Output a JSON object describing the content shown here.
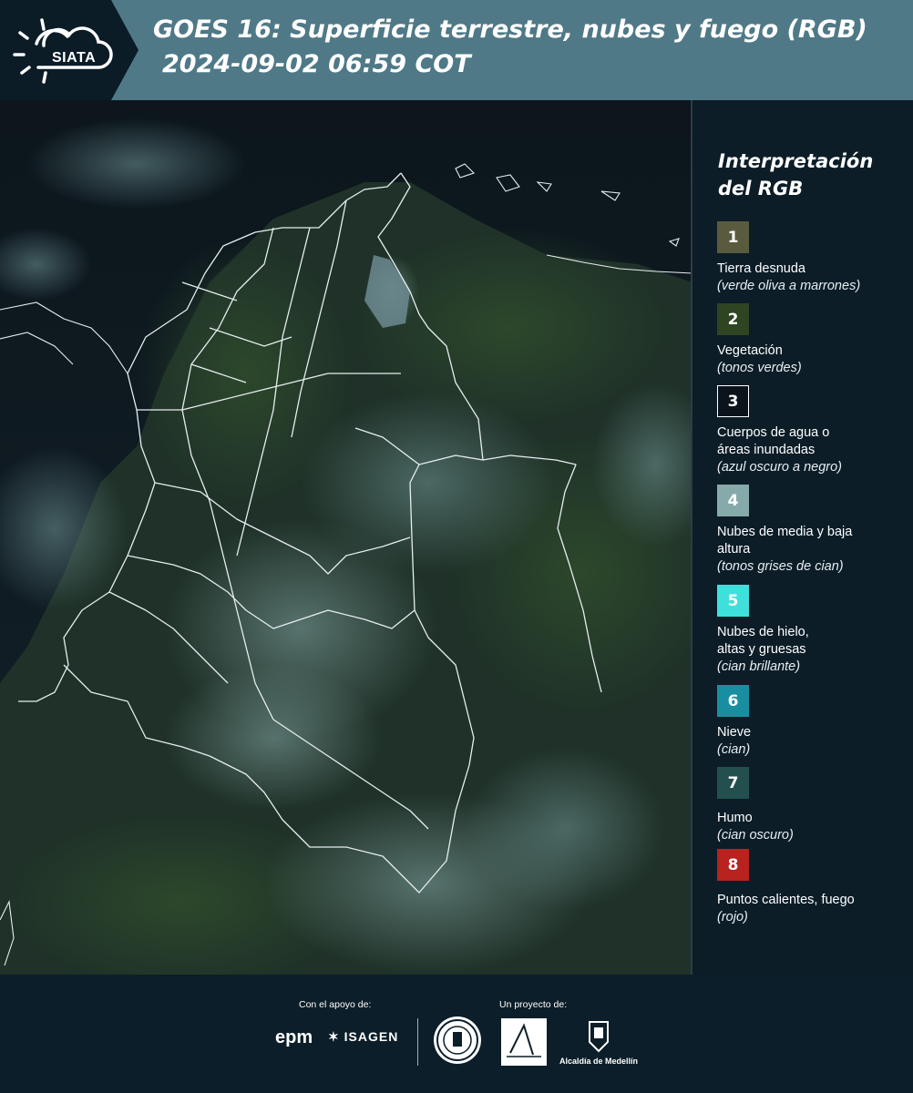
{
  "header": {
    "logo_text": "SIATA",
    "title_line1": "GOES 16: Superficie terrestre, nubes y fuego (RGB)",
    "title_line2": "2024-09-02 06:59 COT"
  },
  "legend": {
    "title": "Interpretación del RGB",
    "items": [
      {
        "number": "1",
        "color": "#5a5b3e",
        "label": "Tierra desnuda",
        "note": "(verde oliva a marrones)"
      },
      {
        "number": "2",
        "color": "#2f4421",
        "label": "Vegetación",
        "note": "(tonos verdes)"
      },
      {
        "number": "3",
        "color": "#0b141b",
        "label": "Cuerpos de agua o áreas inundadas",
        "note": "(azul oscuro a negro)"
      },
      {
        "number": "4",
        "color": "#86aaa9",
        "label": "Nubes de media y baja altura",
        "note": "(tonos grises de cian)"
      },
      {
        "number": "5",
        "color": "#3fe0dc",
        "label": "Nubes de hielo, altas y gruesas",
        "note": "(cian brillante)"
      },
      {
        "number": "6",
        "color": "#1a8ea1",
        "label": "Nieve",
        "note": "(cian)"
      },
      {
        "number": "7",
        "color": "#23504f",
        "label": "Humo",
        "note": "(cian oscuro)"
      },
      {
        "number": "8",
        "color": "#b8221f",
        "label": "Puntos calientes, fuego",
        "note": "(rojo)"
      }
    ]
  },
  "footer": {
    "support_caption": "Con el apoyo de:",
    "project_caption": "Un proyecto de:",
    "sponsors": [
      "epm",
      "ISAGEN"
    ],
    "alcaldia": "Alcaldía de Medellín"
  },
  "colors": {
    "header_bg": "#4f7987",
    "header_dark": "#0b1c27",
    "legend_bg": "#0c1d28",
    "map_ocean": "#0f1d24",
    "map_land": "#1d3026",
    "border_lines": "#e6eef0"
  }
}
